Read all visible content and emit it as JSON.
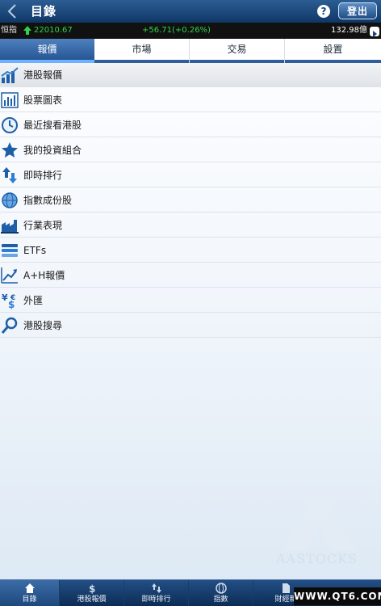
{
  "header": {
    "title": "目錄",
    "help_label": "?",
    "logout_label": "登出"
  },
  "ticker": {
    "name": "恒指",
    "value": "22010.67",
    "change": "+56.71(+0.26%)",
    "turnover": "132.98億"
  },
  "tabs": [
    {
      "label": "報價",
      "active": true
    },
    {
      "label": "市場",
      "active": false
    },
    {
      "label": "交易",
      "active": false
    },
    {
      "label": "設置",
      "active": false
    }
  ],
  "menu": [
    {
      "label": "港股報價",
      "icon": "line-chart-icon",
      "selected": true
    },
    {
      "label": "股票圖表",
      "icon": "bar-chart-icon",
      "selected": false
    },
    {
      "label": "最近搜看港股",
      "icon": "clock-icon",
      "selected": false
    },
    {
      "label": "我的投資組合",
      "icon": "star-icon",
      "selected": false
    },
    {
      "label": "即時排行",
      "icon": "up-down-arrows-icon",
      "selected": false
    },
    {
      "label": "指數成份股",
      "icon": "globe-icon",
      "selected": false
    },
    {
      "label": "行業表現",
      "icon": "industry-icon",
      "selected": false
    },
    {
      "label": "ETFs",
      "icon": "stack-icon",
      "selected": false
    },
    {
      "label": "A+H報價",
      "icon": "trend-arrow-icon",
      "selected": false
    },
    {
      "label": "外匯",
      "icon": "currency-icon",
      "selected": false
    },
    {
      "label": "港股搜尋",
      "icon": "search-icon",
      "selected": false
    }
  ],
  "watermark": "AASTOCKS",
  "bottom_nav": [
    {
      "label": "目錄",
      "icon": "home-icon",
      "active": true
    },
    {
      "label": "港股報價",
      "icon": "dollar-icon",
      "active": false
    },
    {
      "label": "即時排行",
      "icon": "up-down-arrows-icon",
      "active": false
    },
    {
      "label": "指數",
      "icon": "globe-icon",
      "active": false
    },
    {
      "label": "財經新",
      "icon": "document-icon",
      "active": false
    }
  ],
  "brand_badge": "WWW.QT6.COM",
  "colors": {
    "header": "#1a4478",
    "ticker_up": "#2fd24a",
    "tab_active": "#2f5e99"
  }
}
